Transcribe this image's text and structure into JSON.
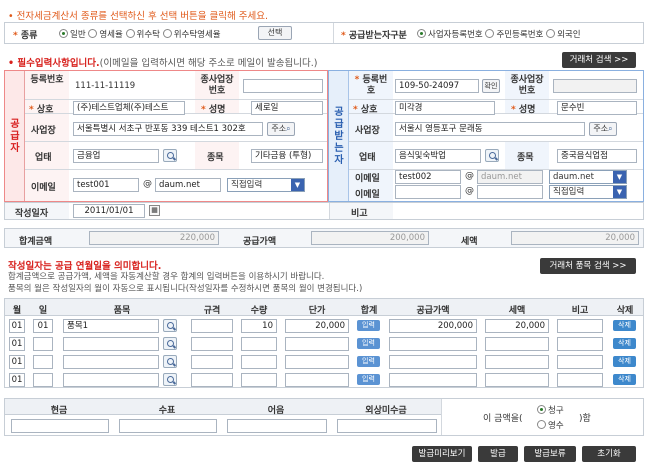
{
  "top_notice": "• 전자세금계산서 종류를 선택하신 후 선택 버튼을 클릭해 주세요.",
  "type_row": {
    "label": "종류",
    "options": [
      "일반",
      "영세율",
      "위수탁",
      "위수탁영세율"
    ],
    "select_button": "선택",
    "receiver_label": "공급받는자구분",
    "receiver_options": [
      "사업자등록번호",
      "주민등록번호",
      "외국인"
    ]
  },
  "required_notice": {
    "main": "• 필수입력사항입니다.",
    "sub": "(이메일을 입력하시면 해당 주소로 메일이 발송됩니다.)"
  },
  "partner_search_button": "거래처 검색 >>",
  "supplier": {
    "side_label": "공급자",
    "reg_no_label": "등록번호",
    "reg_no": "111-11-11119",
    "branch_label": "종사업장번호",
    "name_label": "상호",
    "name": "(주)테스트업체(주)테스트",
    "rep_label": "성명",
    "rep": "세로일",
    "addr_label": "사업장",
    "addr": "서울특별시 서초구 반포동 339 테스트1 302호",
    "addr_btn": "주소",
    "biz_type_label": "업태",
    "biz_type": "금융업",
    "item_label": "종목",
    "item": "기타금융 (투형)",
    "email_label": "이메일",
    "email_id": "test001",
    "email_domain": "daum.net",
    "email_select": "직접입력"
  },
  "receiver": {
    "side_label": "공급받는자",
    "reg_no_label": "등록번호",
    "reg_no": "109-50-24097",
    "confirm_btn": "확인",
    "branch_label": "종사업장번호",
    "name_label": "상호",
    "name": "미각경",
    "rep_label": "성명",
    "rep": "문수빈",
    "addr_label": "사업장",
    "addr": "서울시 영등포구 문래동",
    "addr_btn": "주소",
    "biz_type_label": "업태",
    "biz_type": "음식및숙박업",
    "item_label": "종목",
    "item": "중국음식업점",
    "email_label": "이메일",
    "email_id": "test002",
    "email_domain": "daum.net",
    "email_select": "daum.net",
    "email2_label": "이메일",
    "email2_select": "직접입력"
  },
  "date_row": {
    "label": "작성일자",
    "value": "2011/01/01",
    "remarks_label": "비고"
  },
  "totals": {
    "total_label": "합계금액",
    "total": "220,000",
    "supply_label": "공급가액",
    "supply": "200,000",
    "tax_label": "세액",
    "tax": "20,000"
  },
  "items_notice": {
    "title": "작성일자는 공급 연월일을 의미합니다.",
    "line1": "합계금액으로 공급가액, 세액을 자동계산할 경우 합계의 입력버튼을 이용하시기 바랍니다.",
    "line2": "품목의 월은 작성일자의 월이 자동으로 표시됩니다(작성일자를 수정하시면 품목의 월이 변경됩니다.)"
  },
  "item_search_button": "거래처 품목 검색 >>",
  "item_table": {
    "headers": [
      "월",
      "일",
      "품목",
      "규격",
      "수량",
      "단가",
      "합계",
      "공급가액",
      "세액",
      "비고",
      "삭제"
    ],
    "input_btn": "입력",
    "delete_btn": "삭제",
    "rows": [
      {
        "month": "01",
        "day": "01",
        "item": "품목1",
        "spec": "",
        "qty": "10",
        "price": "20,000",
        "supply": "200,000",
        "tax": "20,000",
        "remark": ""
      },
      {
        "month": "01",
        "day": "",
        "item": "",
        "spec": "",
        "qty": "",
        "price": "",
        "supply": "",
        "tax": "",
        "remark": ""
      },
      {
        "month": "01",
        "day": "",
        "item": "",
        "spec": "",
        "qty": "",
        "price": "",
        "supply": "",
        "tax": "",
        "remark": ""
      },
      {
        "month": "01",
        "day": "",
        "item": "",
        "spec": "",
        "qty": "",
        "price": "",
        "supply": "",
        "tax": "",
        "remark": ""
      }
    ]
  },
  "payment": {
    "headers": [
      "현금",
      "수표",
      "어음",
      "외상미수금"
    ],
    "amount_prefix": "이 금액을(",
    "options": [
      "청구",
      "영수"
    ],
    "amount_suffix": ")함"
  },
  "footer_buttons": [
    "발급미리보기",
    "발급",
    "발급보류",
    "초기화"
  ]
}
